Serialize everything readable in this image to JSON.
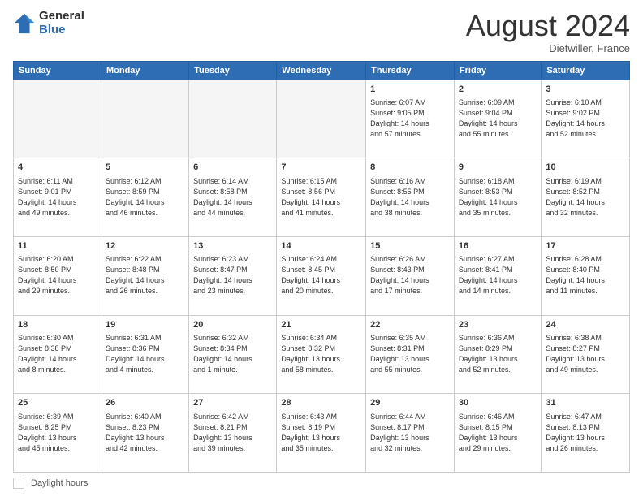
{
  "logo": {
    "general": "General",
    "blue": "Blue"
  },
  "title": "August 2024",
  "subtitle": "Dietwiller, France",
  "days_of_week": [
    "Sunday",
    "Monday",
    "Tuesday",
    "Wednesday",
    "Thursday",
    "Friday",
    "Saturday"
  ],
  "footer_label": "Daylight hours",
  "weeks": [
    [
      {
        "day": "",
        "info": ""
      },
      {
        "day": "",
        "info": ""
      },
      {
        "day": "",
        "info": ""
      },
      {
        "day": "",
        "info": ""
      },
      {
        "day": "1",
        "info": "Sunrise: 6:07 AM\nSunset: 9:05 PM\nDaylight: 14 hours\nand 57 minutes."
      },
      {
        "day": "2",
        "info": "Sunrise: 6:09 AM\nSunset: 9:04 PM\nDaylight: 14 hours\nand 55 minutes."
      },
      {
        "day": "3",
        "info": "Sunrise: 6:10 AM\nSunset: 9:02 PM\nDaylight: 14 hours\nand 52 minutes."
      }
    ],
    [
      {
        "day": "4",
        "info": "Sunrise: 6:11 AM\nSunset: 9:01 PM\nDaylight: 14 hours\nand 49 minutes."
      },
      {
        "day": "5",
        "info": "Sunrise: 6:12 AM\nSunset: 8:59 PM\nDaylight: 14 hours\nand 46 minutes."
      },
      {
        "day": "6",
        "info": "Sunrise: 6:14 AM\nSunset: 8:58 PM\nDaylight: 14 hours\nand 44 minutes."
      },
      {
        "day": "7",
        "info": "Sunrise: 6:15 AM\nSunset: 8:56 PM\nDaylight: 14 hours\nand 41 minutes."
      },
      {
        "day": "8",
        "info": "Sunrise: 6:16 AM\nSunset: 8:55 PM\nDaylight: 14 hours\nand 38 minutes."
      },
      {
        "day": "9",
        "info": "Sunrise: 6:18 AM\nSunset: 8:53 PM\nDaylight: 14 hours\nand 35 minutes."
      },
      {
        "day": "10",
        "info": "Sunrise: 6:19 AM\nSunset: 8:52 PM\nDaylight: 14 hours\nand 32 minutes."
      }
    ],
    [
      {
        "day": "11",
        "info": "Sunrise: 6:20 AM\nSunset: 8:50 PM\nDaylight: 14 hours\nand 29 minutes."
      },
      {
        "day": "12",
        "info": "Sunrise: 6:22 AM\nSunset: 8:48 PM\nDaylight: 14 hours\nand 26 minutes."
      },
      {
        "day": "13",
        "info": "Sunrise: 6:23 AM\nSunset: 8:47 PM\nDaylight: 14 hours\nand 23 minutes."
      },
      {
        "day": "14",
        "info": "Sunrise: 6:24 AM\nSunset: 8:45 PM\nDaylight: 14 hours\nand 20 minutes."
      },
      {
        "day": "15",
        "info": "Sunrise: 6:26 AM\nSunset: 8:43 PM\nDaylight: 14 hours\nand 17 minutes."
      },
      {
        "day": "16",
        "info": "Sunrise: 6:27 AM\nSunset: 8:41 PM\nDaylight: 14 hours\nand 14 minutes."
      },
      {
        "day": "17",
        "info": "Sunrise: 6:28 AM\nSunset: 8:40 PM\nDaylight: 14 hours\nand 11 minutes."
      }
    ],
    [
      {
        "day": "18",
        "info": "Sunrise: 6:30 AM\nSunset: 8:38 PM\nDaylight: 14 hours\nand 8 minutes."
      },
      {
        "day": "19",
        "info": "Sunrise: 6:31 AM\nSunset: 8:36 PM\nDaylight: 14 hours\nand 4 minutes."
      },
      {
        "day": "20",
        "info": "Sunrise: 6:32 AM\nSunset: 8:34 PM\nDaylight: 14 hours\nand 1 minute."
      },
      {
        "day": "21",
        "info": "Sunrise: 6:34 AM\nSunset: 8:32 PM\nDaylight: 13 hours\nand 58 minutes."
      },
      {
        "day": "22",
        "info": "Sunrise: 6:35 AM\nSunset: 8:31 PM\nDaylight: 13 hours\nand 55 minutes."
      },
      {
        "day": "23",
        "info": "Sunrise: 6:36 AM\nSunset: 8:29 PM\nDaylight: 13 hours\nand 52 minutes."
      },
      {
        "day": "24",
        "info": "Sunrise: 6:38 AM\nSunset: 8:27 PM\nDaylight: 13 hours\nand 49 minutes."
      }
    ],
    [
      {
        "day": "25",
        "info": "Sunrise: 6:39 AM\nSunset: 8:25 PM\nDaylight: 13 hours\nand 45 minutes."
      },
      {
        "day": "26",
        "info": "Sunrise: 6:40 AM\nSunset: 8:23 PM\nDaylight: 13 hours\nand 42 minutes."
      },
      {
        "day": "27",
        "info": "Sunrise: 6:42 AM\nSunset: 8:21 PM\nDaylight: 13 hours\nand 39 minutes."
      },
      {
        "day": "28",
        "info": "Sunrise: 6:43 AM\nSunset: 8:19 PM\nDaylight: 13 hours\nand 35 minutes."
      },
      {
        "day": "29",
        "info": "Sunrise: 6:44 AM\nSunset: 8:17 PM\nDaylight: 13 hours\nand 32 minutes."
      },
      {
        "day": "30",
        "info": "Sunrise: 6:46 AM\nSunset: 8:15 PM\nDaylight: 13 hours\nand 29 minutes."
      },
      {
        "day": "31",
        "info": "Sunrise: 6:47 AM\nSunset: 8:13 PM\nDaylight: 13 hours\nand 26 minutes."
      }
    ]
  ]
}
